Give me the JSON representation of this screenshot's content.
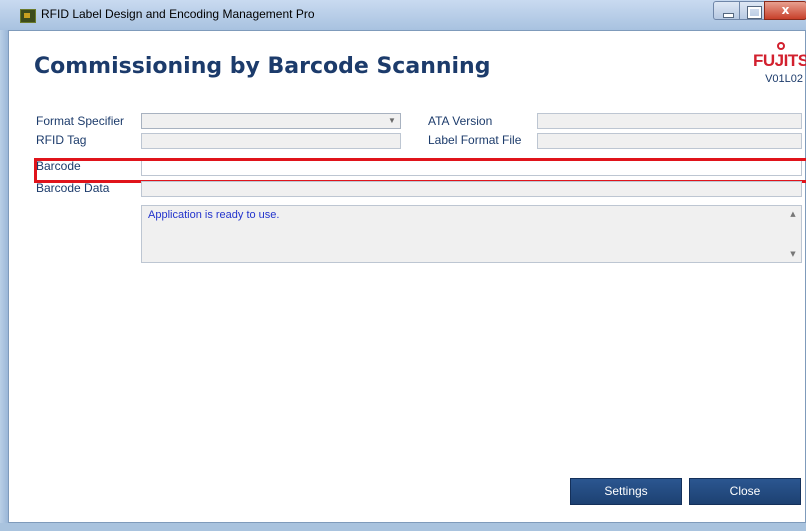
{
  "window": {
    "title": "RFID Label Design and Encoding Management Pro",
    "controls": {
      "minimize_icon": "minimize-icon",
      "maximize_icon": "maximize-icon",
      "close_glyph": "x"
    }
  },
  "header": {
    "title": "Commissioning by Barcode Scanning",
    "logo_text": "FUJITSU",
    "version": "V01L02"
  },
  "form": {
    "format_specifier_label": "Format Specifier",
    "format_specifier_value": "",
    "rfid_tag_label": "RFID Tag",
    "rfid_tag_value": "",
    "barcode_label": "Barcode",
    "barcode_value": "",
    "barcode_data_label": "Barcode Data",
    "barcode_data_value": "",
    "ata_version_label": "ATA Version",
    "ata_version_value": "",
    "label_format_file_label": "Label Format File",
    "label_format_file_value": ""
  },
  "status": {
    "message": "Application is ready to use."
  },
  "buttons": {
    "settings": "Settings",
    "close": "Close"
  },
  "colors": {
    "accent": "#1c3b6b",
    "highlight": "#e0141b",
    "button": "#2b5690",
    "status_text": "#2233cc",
    "logo": "#d2202e"
  }
}
